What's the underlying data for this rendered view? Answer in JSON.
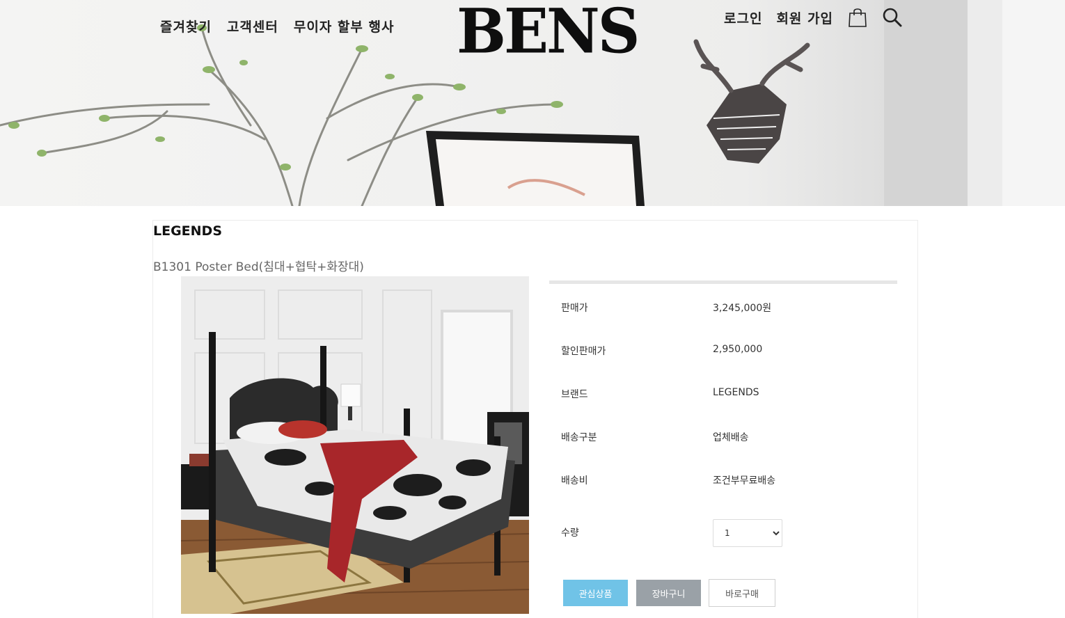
{
  "header": {
    "nav_left": [
      "즐겨찾기",
      "고객센터",
      "무이자 할부 행사"
    ],
    "logo_text": "BENS",
    "nav_right": [
      "로그인",
      "회원 가입"
    ],
    "icons": {
      "cart": "shopping-bag-icon",
      "search": "search-icon"
    }
  },
  "product": {
    "brand": "LEGENDS",
    "name": "B1301 Poster Bed(침대+협탁+화장대)",
    "info": [
      {
        "label": "판매가",
        "value": "3,245,000원"
      },
      {
        "label": "할인판매가",
        "value": "2,950,000"
      },
      {
        "label": "브랜드",
        "value": "LEGENDS"
      },
      {
        "label": "배송구분",
        "value": "업체배송"
      },
      {
        "label": "배송비",
        "value": "조건부무료배송"
      }
    ],
    "quantity": {
      "label": "수량",
      "selected": "1",
      "options": [
        "1"
      ]
    },
    "buttons": {
      "wishlist": "관심상품",
      "cart": "장바구니",
      "buy_now": "바로구매"
    }
  },
  "colors": {
    "wishlist_button": "#70c3e7",
    "cart_button": "#9aa1a7",
    "logo": "#0e0e0e"
  }
}
